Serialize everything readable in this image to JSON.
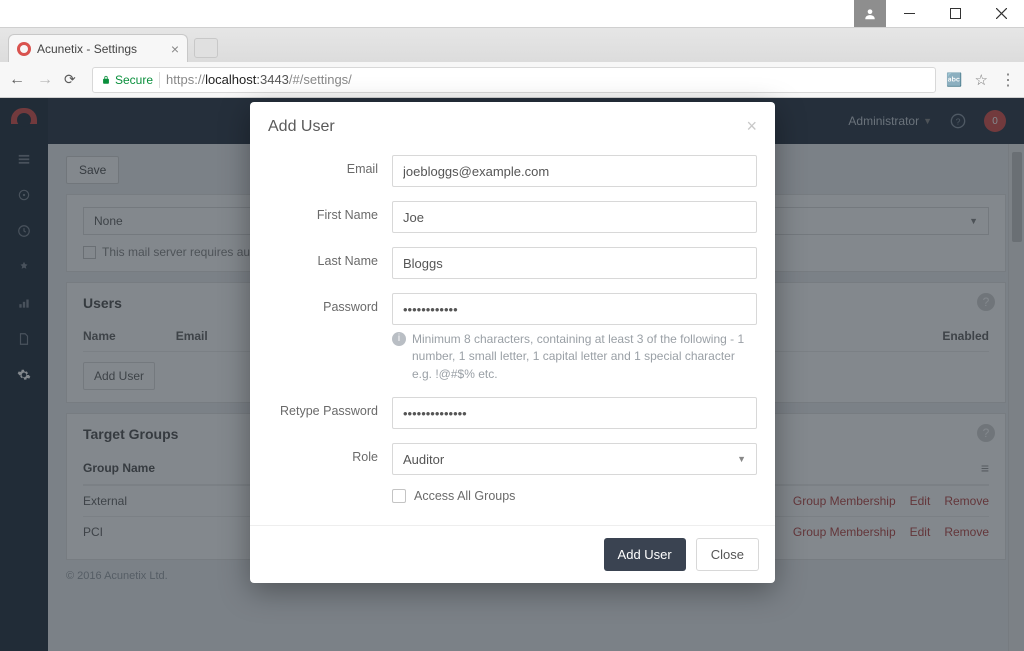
{
  "window": {
    "tab_title": "Acunetix - Settings",
    "secure_label": "Secure",
    "url_proto": "https://",
    "url_host": "localhost",
    "url_port": ":3443",
    "url_path": "/#/settings/"
  },
  "topbar": {
    "user_label": "Administrator",
    "notification_count": "0"
  },
  "toolbar": {
    "save_label": "Save"
  },
  "mail_panel": {
    "select_value": "None",
    "requires_auth_label": "This mail server requires authentication"
  },
  "users_panel": {
    "title": "Users",
    "col_name": "Name",
    "col_email": "Email",
    "col_enabled": "Enabled",
    "add_user_label": "Add User"
  },
  "groups_panel": {
    "title": "Target Groups",
    "col_group_name": "Group Name",
    "rows": [
      {
        "name": "External",
        "membership": "Group Membership",
        "edit": "Edit",
        "remove": "Remove"
      },
      {
        "name": "PCI",
        "membership": "Group Membership",
        "edit": "Edit",
        "remove": "Remove"
      }
    ]
  },
  "footer": {
    "copyright": "© 2016 Acunetix Ltd."
  },
  "modal": {
    "title": "Add User",
    "labels": {
      "email": "Email",
      "first_name": "First Name",
      "last_name": "Last Name",
      "password": "Password",
      "retype_password": "Retype Password",
      "role": "Role",
      "access_all": "Access All Groups"
    },
    "values": {
      "email": "joebloggs@example.com",
      "first_name": "Joe",
      "last_name": "Bloggs",
      "password": "••••••••••••",
      "retype_password": "••••••••••••••",
      "role": "Auditor"
    },
    "password_hint": "Minimum 8 characters, containing at least 3 of the following - 1 number, 1 small letter, 1 capital letter and 1 special character e.g. !@#$% etc.",
    "buttons": {
      "primary": "Add User",
      "close": "Close"
    }
  }
}
